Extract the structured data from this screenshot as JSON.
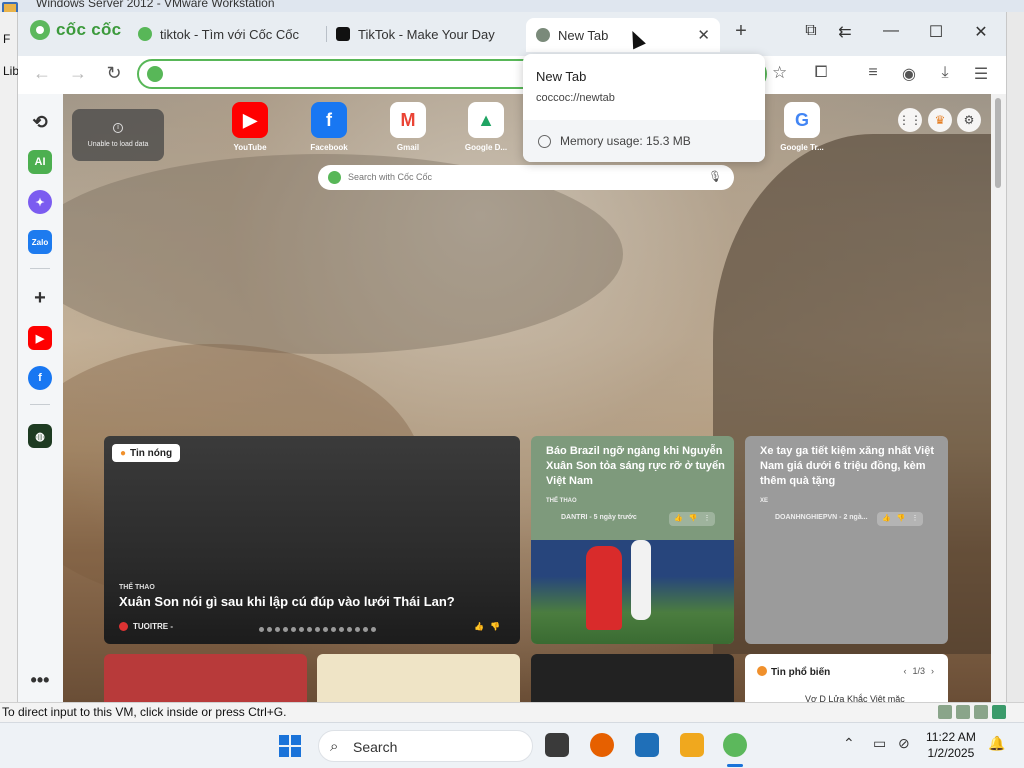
{
  "vm": {
    "window_title": "Windows Server 2012 - VMware Workstation",
    "left_fragments": [
      "F",
      "Lib"
    ],
    "status_text": "To direct input to this VM, click inside or press Ctrl+G."
  },
  "browser": {
    "logo_text": "cốc cốc",
    "tabs": [
      {
        "label": "tiktok - Tìm với Cốc Cốc",
        "favicon": "coccoc-search-icon"
      },
      {
        "label": "TikTok - Make Your Day",
        "favicon": "tiktok-icon"
      },
      {
        "label": "New Tab",
        "favicon": "coccoc-icon",
        "close": "✕"
      }
    ],
    "new_tab_symbol": "+",
    "omnibox_value": "",
    "tab_popup": {
      "title": "New Tab",
      "url": "coccoc://newtab",
      "memory": "Memory usage: 15.3 MB"
    }
  },
  "newtab": {
    "unable_text": "Unable to load data",
    "speed_dial": [
      {
        "label": "YouTube",
        "glyph": "▶",
        "color": "#ff0000"
      },
      {
        "label": "Facebook",
        "glyph": "f",
        "color": "#1877f2"
      },
      {
        "label": "Gmail",
        "glyph": "M",
        "color": "#ea4335"
      },
      {
        "label": "Google D...",
        "glyph": "▲",
        "color": "#1fa463"
      },
      {
        "label": "Google Tr...",
        "glyph": "G",
        "color": "#4285f4"
      }
    ],
    "search_placeholder": "Search with Cốc Cốc",
    "main_story": {
      "badge": "Tin nóng",
      "category": "THỂ THAO",
      "title": "Xuân Son nói gì sau khi lập cú đúp vào lưới Thái Lan?",
      "source": "TUOITRE -"
    },
    "story2": {
      "title": "Báo Brazil ngỡ ngàng khi Nguyễn Xuân Son tỏa sáng rực rỡ ở tuyển Việt Nam",
      "category": "THỂ THAO",
      "source": "DANTRI - 5 ngày trước"
    },
    "story3": {
      "title": "Xe tay ga tiết kiệm xăng nhất Việt Nam giá dưới 6 triệu đồng, kèm thêm quà tặng",
      "category": "XE",
      "source": "DOANHNGHIEPVN - 2 ngà..."
    },
    "popular": {
      "title": "Tin phổ biến",
      "pager": "1/3",
      "first_item": "Vợ D Lửa Khắc Việt mặc"
    }
  },
  "taskbar": {
    "search_label": "Search",
    "time": "11:22 AM",
    "date": "1/2/2025"
  }
}
